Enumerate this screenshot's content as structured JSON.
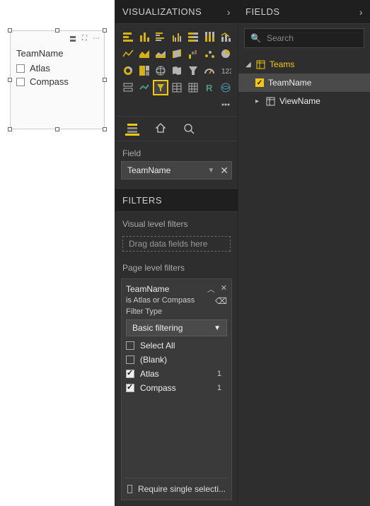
{
  "canvas": {
    "slicer": {
      "title": "TeamName",
      "options": [
        "Atlas",
        "Compass"
      ]
    }
  },
  "viz_panel": {
    "title": "VISUALIZATIONS",
    "field_section_label": "Field",
    "field_well_value": "TeamName",
    "filters_title": "FILTERS",
    "visual_filters_label": "Visual level filters",
    "visual_filters_hint": "Drag data fields here",
    "page_filters_label": "Page level filters",
    "filter_card": {
      "name": "TeamName",
      "summary": "is Atlas or Compass",
      "type_label": "Filter Type",
      "type_value": "Basic filtering",
      "options": [
        {
          "label": "Select All",
          "checked": false,
          "count": null
        },
        {
          "label": "(Blank)",
          "checked": false,
          "count": null
        },
        {
          "label": "Atlas",
          "checked": true,
          "count": "1"
        },
        {
          "label": "Compass",
          "checked": true,
          "count": "1"
        }
      ],
      "require_single": "Require single selecti..."
    }
  },
  "fields_panel": {
    "title": "FIELDS",
    "search_placeholder": "Search",
    "tables": [
      {
        "name": "Teams",
        "expanded": true,
        "fields": [
          {
            "name": "TeamName",
            "checked": true,
            "selected": true
          },
          {
            "name": "ViewName",
            "checked": false,
            "selected": false
          }
        ]
      }
    ]
  }
}
